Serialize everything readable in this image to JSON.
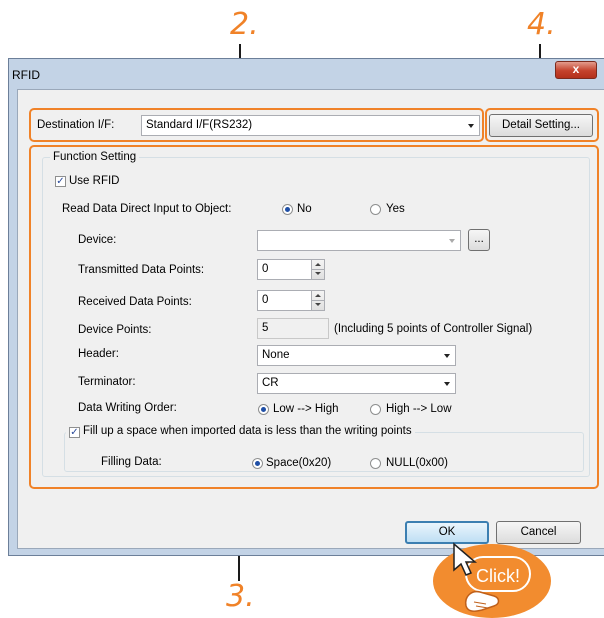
{
  "callouts": {
    "c2": "2.",
    "c3": "3.",
    "c4": "4.",
    "click": "Click!"
  },
  "colors": {
    "highlight": "#f08228",
    "window_frame": "#c3d3e6",
    "dialog_bg": "#f0f0f0"
  },
  "window": {
    "title": "RFID",
    "close_label": "x"
  },
  "destination": {
    "label": "Destination I/F:",
    "value": "Standard I/F(RS232)",
    "detail_button": "Detail Setting..."
  },
  "function_setting": {
    "group_title": "Function Setting",
    "use_rfid": {
      "label": "Use RFID",
      "checked": true
    },
    "read_direct": {
      "label": "Read Data Direct Input to Object:",
      "options": [
        "No",
        "Yes"
      ],
      "selected": "No"
    },
    "device": {
      "label": "Device:",
      "value": "",
      "browse_label": "..."
    },
    "transmitted": {
      "label": "Transmitted Data Points:",
      "value": "0"
    },
    "received": {
      "label": "Received Data Points:",
      "value": "0"
    },
    "device_points": {
      "label": "Device Points:",
      "value": "5",
      "note": "(Including 5 points of Controller Signal)"
    },
    "header": {
      "label": "Header:",
      "value": "None"
    },
    "terminator": {
      "label": "Terminator:",
      "value": "CR"
    },
    "writing_order": {
      "label": "Data Writing Order:",
      "options": [
        "Low --> High",
        "High --> Low"
      ],
      "selected": "Low --> High"
    },
    "fill_group": {
      "label": "Fill up a space when imported data is less than the writing points",
      "checked": true,
      "filling_label": "Filling Data:",
      "options": [
        "Space(0x20)",
        "NULL(0x00)"
      ],
      "selected": "Space(0x20)"
    }
  },
  "buttons": {
    "ok": "OK",
    "cancel": "Cancel"
  },
  "icons": [
    "close-icon",
    "dropdown-arrow-icon",
    "spin-up-icon",
    "spin-down-icon",
    "checkbox-check-icon",
    "hand-cursor-icon"
  ]
}
